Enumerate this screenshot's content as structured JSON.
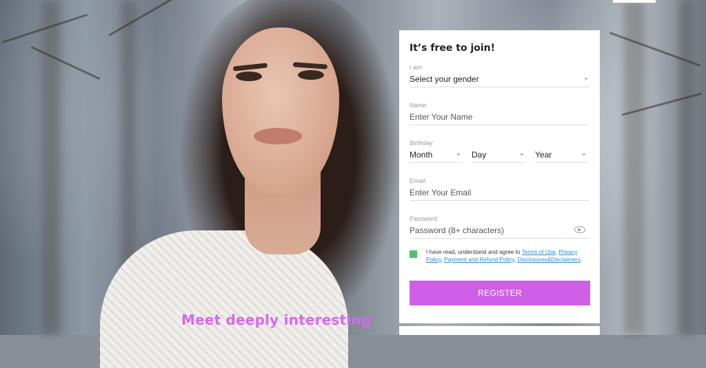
{
  "hero": {
    "tagline": "Meet deeply interesting"
  },
  "form": {
    "title": "It’s free to join!",
    "gender": {
      "label": "I am:",
      "value": "Select your gender"
    },
    "name": {
      "label": "Name:",
      "placeholder": "Enter Your Name"
    },
    "birthday": {
      "label": "Birthday:",
      "month": "Month",
      "day": "Day",
      "year": "Year"
    },
    "email": {
      "label": "Email:",
      "placeholder": "Enter Your Email"
    },
    "password": {
      "label": "Password:",
      "placeholder": "Password (8+ characters)"
    },
    "consent": {
      "prefix": "I have read, understand and agree to ",
      "link1": "Terms of Use",
      "sep1": ", ",
      "link2": "Privacy Policy",
      "sep2": ", ",
      "link3": "Payment and Refund Policy",
      "sep3": ", ",
      "link4": "Disclosures&Disclaimers",
      "suffix": ".",
      "checked": true
    },
    "register_label": "REGISTER"
  },
  "colors": {
    "accent": "#cf5fe6",
    "tagline": "#d768f0",
    "checkbox": "#4cc26a",
    "link": "#2b8bd8"
  }
}
